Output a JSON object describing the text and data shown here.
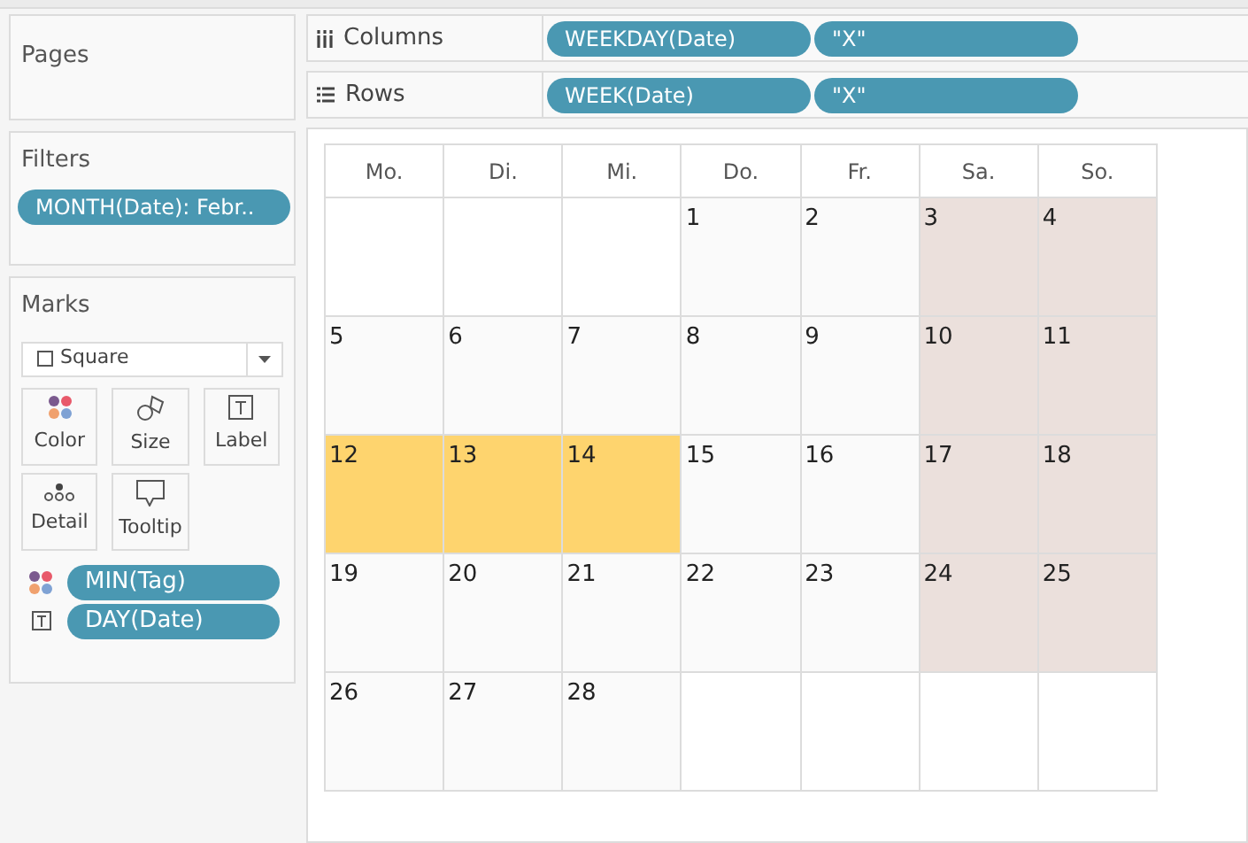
{
  "pages": {
    "title": "Pages"
  },
  "filters": {
    "title": "Filters",
    "pills": [
      "MONTH(Date): Febr.."
    ]
  },
  "marks": {
    "title": "Marks",
    "mark_type": "Square",
    "buttons": [
      {
        "kind": "color",
        "label": "Color"
      },
      {
        "kind": "size",
        "label": "Size"
      },
      {
        "kind": "label",
        "label": "Label"
      },
      {
        "kind": "detail",
        "label": "Detail"
      },
      {
        "kind": "tooltip",
        "label": "Tooltip"
      }
    ],
    "fields": [
      {
        "kind": "color",
        "label": "MIN(Tag)"
      },
      {
        "kind": "label",
        "label": "DAY(Date)"
      }
    ]
  },
  "shelves": [
    {
      "kind": "columns",
      "label": "Columns",
      "pills": [
        "WEEKDAY(Date)",
        "\"X\""
      ]
    },
    {
      "kind": "rows",
      "label": "Rows",
      "pills": [
        "WEEK(Date)",
        "\"X\""
      ]
    }
  ],
  "calendar": {
    "headers": [
      "Mo.",
      "Di.",
      "Mi.",
      "Do.",
      "Fr.",
      "Sa.",
      "So."
    ],
    "weeks": [
      [
        {
          "color": "#ffffff"
        },
        {
          "color": "#ffffff"
        },
        {
          "color": "#ffffff"
        },
        {
          "day": "1",
          "color": "#fafafa"
        },
        {
          "day": "2",
          "color": "#fafafa"
        },
        {
          "day": "3",
          "color": "#ebe0dc"
        },
        {
          "day": "4",
          "color": "#ebe0dc"
        }
      ],
      [
        {
          "day": "5",
          "color": "#fafafa"
        },
        {
          "day": "6",
          "color": "#fafafa"
        },
        {
          "day": "7",
          "color": "#fafafa"
        },
        {
          "day": "8",
          "color": "#fafafa"
        },
        {
          "day": "9",
          "color": "#fafafa"
        },
        {
          "day": "10",
          "color": "#ebe0dc"
        },
        {
          "day": "11",
          "color": "#ebe0dc"
        }
      ],
      [
        {
          "day": "12",
          "color": "#fed46e"
        },
        {
          "day": "13",
          "color": "#fed46e"
        },
        {
          "day": "14",
          "color": "#fed46e"
        },
        {
          "day": "15",
          "color": "#fafafa"
        },
        {
          "day": "16",
          "color": "#fafafa"
        },
        {
          "day": "17",
          "color": "#ebe0dc"
        },
        {
          "day": "18",
          "color": "#ebe0dc"
        }
      ],
      [
        {
          "day": "19",
          "color": "#fafafa"
        },
        {
          "day": "20",
          "color": "#fafafa"
        },
        {
          "day": "21",
          "color": "#fafafa"
        },
        {
          "day": "22",
          "color": "#fafafa"
        },
        {
          "day": "23",
          "color": "#fafafa"
        },
        {
          "day": "24",
          "color": "#ebe0dc"
        },
        {
          "day": "25",
          "color": "#ebe0dc"
        }
      ],
      [
        {
          "day": "26",
          "color": "#fafafa"
        },
        {
          "day": "27",
          "color": "#fafafa"
        },
        {
          "day": "28",
          "color": "#fafafa"
        },
        {
          "color": "#ffffff"
        },
        {
          "color": "#ffffff"
        },
        {
          "color": "#ffffff"
        },
        {
          "color": "#ffffff"
        }
      ]
    ]
  }
}
